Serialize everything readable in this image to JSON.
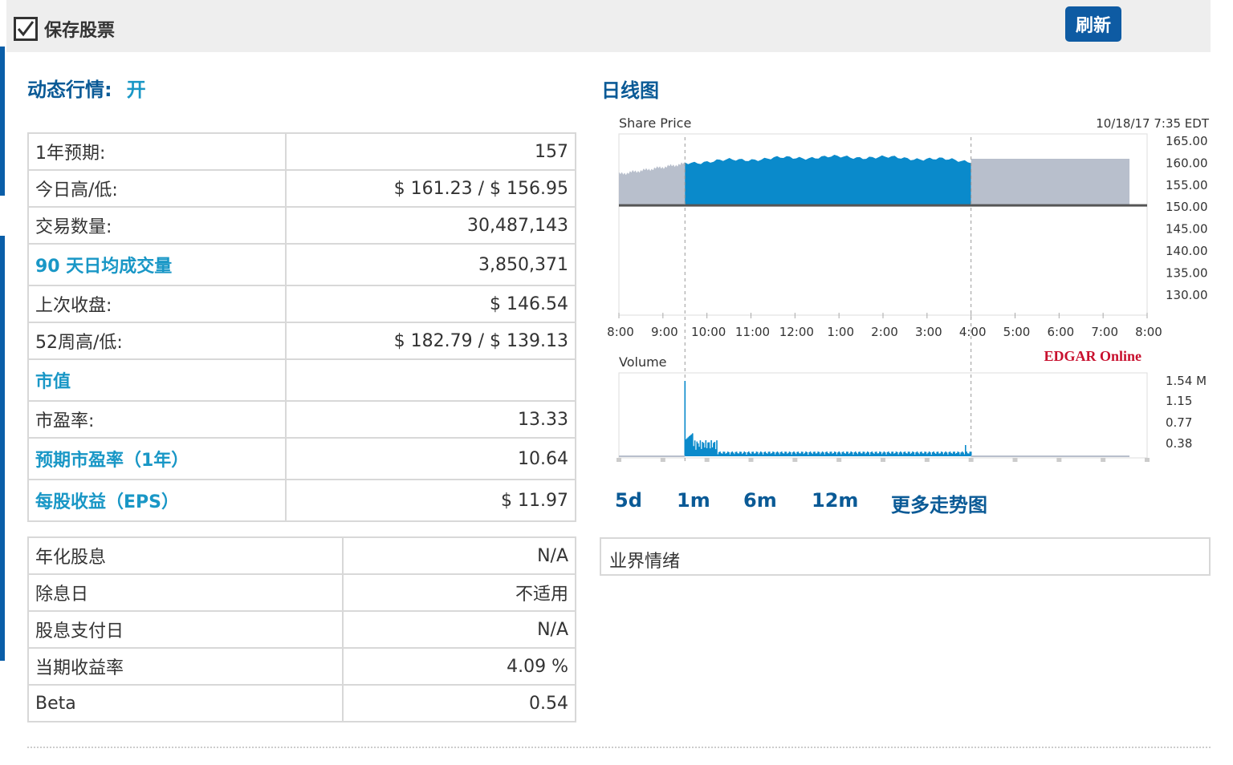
{
  "header": {
    "save_label": "保存股票",
    "refresh_label": "刷新"
  },
  "quote": {
    "label": "动态行情:",
    "value": "开"
  },
  "stats": [
    {
      "label": "1年预期:",
      "value": "157",
      "link": false
    },
    {
      "label": "今日高/低:",
      "value": "$ 161.23 / $ 156.95",
      "link": false
    },
    {
      "label": "交易数量:",
      "value": "30,487,143",
      "link": false
    },
    {
      "label": "90 天日均成交量",
      "value": "3,850,371",
      "link": true
    },
    {
      "label": "上次收盘:",
      "value": "$ 146.54",
      "link": false
    },
    {
      "label": "52周高/低:",
      "value": "$ 182.79 / $ 139.13",
      "link": false
    },
    {
      "label": "市值",
      "value": "",
      "link": true
    },
    {
      "label": "市盈率:",
      "value": "13.33",
      "link": false
    },
    {
      "label": "预期市盈率（1年）",
      "value": "10.64",
      "link": true
    },
    {
      "label": "每股收益（EPS）",
      "value": "$ 11.97",
      "link": true
    }
  ],
  "dividends": [
    {
      "label": "年化股息",
      "value": "N/A"
    },
    {
      "label": "除息日",
      "value": "不适用"
    },
    {
      "label": "股息支付日",
      "value": "N/A"
    },
    {
      "label": "当期收益率",
      "value": "4.09 %"
    },
    {
      "label": "Beta",
      "value": "0.54"
    }
  ],
  "chart": {
    "title": "日线图",
    "price_label": "Share Price",
    "timestamp": "10/18/17  7:35 EDT",
    "volume_label": "Volume",
    "source": "EDGAR Online",
    "y_ticks": [
      "165.00",
      "160.00",
      "155.00",
      "150.00",
      "145.00",
      "140.00",
      "135.00",
      "130.00"
    ],
    "x_ticks": [
      "8:00",
      "9:00",
      "10:00",
      "11:00",
      "12:00",
      "1:00",
      "2:00",
      "3:00",
      "4:00",
      "5:00",
      "6:00",
      "7:00",
      "8:00"
    ],
    "vol_ticks": [
      "1.54 M",
      "1.15",
      "0.77",
      "0.38"
    ],
    "colors": {
      "regular": "#0a8acb",
      "extended": "#b8bfcc"
    }
  },
  "periods": [
    "5d",
    "1m",
    "6m",
    "12m",
    "更多走势图"
  ],
  "sentiment_label": "业界情绪"
}
